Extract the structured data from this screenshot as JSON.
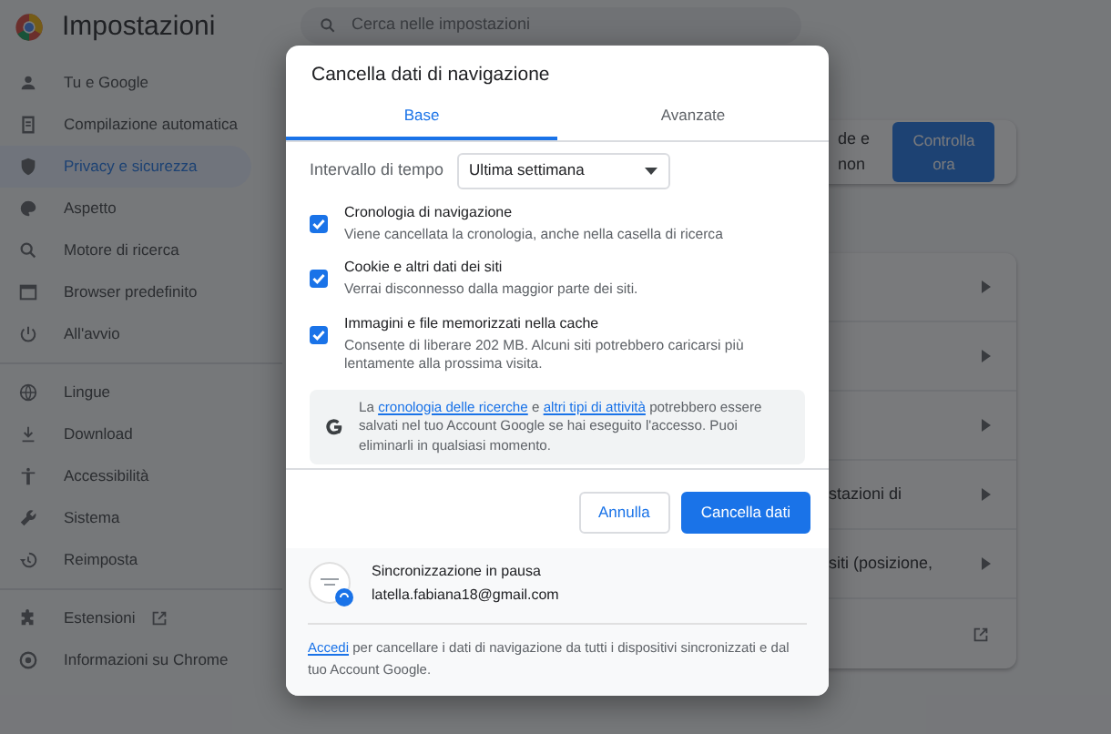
{
  "header": {
    "title": "Impostazioni"
  },
  "search": {
    "placeholder": "Cerca nelle impostazioni"
  },
  "sidebar": {
    "groups": [
      [
        {
          "label": "Tu e Google",
          "selected": false
        },
        {
          "label": "Compilazione automatica",
          "selected": false
        },
        {
          "label": "Privacy e sicurezza",
          "selected": true
        },
        {
          "label": "Aspetto",
          "selected": false
        },
        {
          "label": "Motore di ricerca",
          "selected": false
        },
        {
          "label": "Browser predefinito",
          "selected": false
        },
        {
          "label": "All'avvio",
          "selected": false
        }
      ],
      [
        {
          "label": "Lingue",
          "selected": false
        },
        {
          "label": "Download",
          "selected": false
        },
        {
          "label": "Accessibilità",
          "selected": false
        },
        {
          "label": "Sistema",
          "selected": false
        },
        {
          "label": "Reimposta",
          "selected": false
        }
      ],
      [
        {
          "label": "Estensioni",
          "selected": false,
          "external": true
        },
        {
          "label": "Informazioni su Chrome",
          "selected": false
        }
      ]
    ]
  },
  "safety_card": {
    "text": "de e non",
    "button": "Controlla ora"
  },
  "settings_rows": [
    {
      "kind": "chevron"
    },
    {
      "kind": "chevron"
    },
    {
      "kind": "chevron"
    },
    {
      "text": "stazioni di",
      "kind": "chevron"
    },
    {
      "text": "siti (posizione,",
      "kind": "chevron"
    },
    {
      "kind": "external"
    }
  ],
  "dialog": {
    "title": "Cancella dati di navigazione",
    "tabs": [
      {
        "label": "Base",
        "selected": true
      },
      {
        "label": "Avanzate",
        "selected": false
      }
    ],
    "time_range": {
      "label": "Intervallo di tempo",
      "value": "Ultima settimana"
    },
    "options": [
      {
        "title": "Cronologia di navigazione",
        "description": "Viene cancellata la cronologia, anche nella casella di ricerca",
        "checked": true
      },
      {
        "title": "Cookie e altri dati dei siti",
        "description": "Verrai disconnesso dalla maggior parte dei siti.",
        "checked": true
      },
      {
        "title": "Immagini e file memorizzati nella cache",
        "description": "Consente di liberare 202 MB. Alcuni siti potrebbero caricarsi più lentamente alla prossima visita.",
        "checked": true
      }
    ],
    "info": [
      {
        "text": "La "
      },
      {
        "text": "cronologia delle ricerche",
        "link": true
      },
      {
        "text": " e "
      },
      {
        "text": "altri tipi di attività",
        "link": true
      },
      {
        "text": " potrebbero essere salvati nel tuo Account Google se hai eseguito l'accesso. Puoi eliminarli in qualsiasi momento."
      }
    ],
    "buttons": [
      {
        "label": "Annulla",
        "kind": "secondary"
      },
      {
        "label": "Cancella dati",
        "kind": "primary"
      }
    ],
    "sync": {
      "status": "Sincronizzazione in pausa",
      "email": "latella.fabiana18@gmail.com"
    },
    "footer": [
      {
        "text": "Accedi",
        "link": true
      },
      {
        "text": " per cancellare i dati di navigazione da tutti i dispositivi sincronizzati e dal tuo Account Google."
      }
    ]
  }
}
